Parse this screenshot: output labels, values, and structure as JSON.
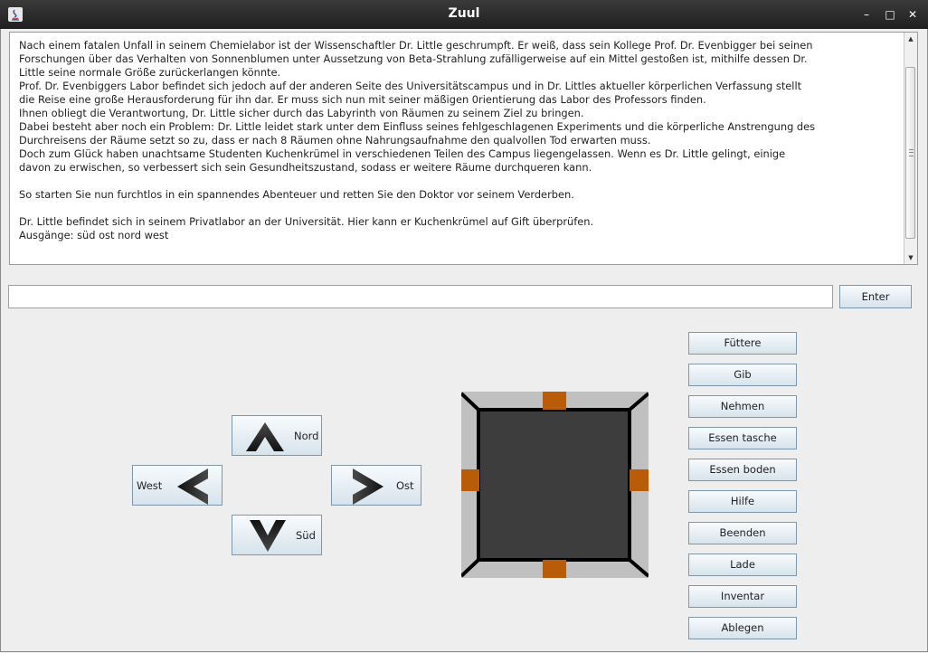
{
  "window": {
    "title": "Zuul",
    "minimize": "–",
    "maximize": "□",
    "close": "✕"
  },
  "story": {
    "text": "Nach einem fatalen Unfall in seinem Chemielabor ist der Wissenschaftler Dr. Little geschrumpft. Er weiß, dass sein Kollege Prof. Dr. Evenbigger bei seinen\nForschungen über das Verhalten von Sonnenblumen unter Aussetzung von Beta-Strahlung zufälligerweise auf ein Mittel gestoßen ist, mithilfe dessen Dr.\nLittle seine normale Größe zurückerlangen könnte.\nProf. Dr. Evenbiggers Labor befindet sich jedoch auf der anderen Seite des Universitätscampus und in Dr. Littles aktueller körperlichen Verfassung stellt\ndie Reise eine große Herausforderung für ihn dar. Er muss sich nun mit seiner mäßigen 0rientierung das Labor des Professors finden.\nIhnen obliegt die Verantwortung, Dr. Little sicher durch das Labyrinth von Räumen zu seinem Ziel zu bringen.\nDabei besteht aber noch ein Problem: Dr. Little leidet stark unter dem Einfluss seines fehlgeschlagenen Experiments und die körperliche Anstrengung des\nDurchreisens der Räume setzt so zu, dass er nach 8 Räumen ohne Nahrungsaufnahme den qualvollen Tod erwarten muss.\nDoch zum Glück haben unachtsame Studenten Kuchenkrümel in verschiedenen Teilen des Campus liegengelassen. Wenn es Dr. Little gelingt, einige\ndavon zu erwischen, so verbessert sich sein Gesundheitszustand, sodass er weitere Räume durchqueren kann.\n\nSo starten Sie nun furchtlos in ein spannendes Abenteuer und retten Sie den Doktor vor seinem Verderben.\n\nDr. Little befindet sich in seinem Privatlabor an der Universität. Hier kann er Kuchenkrümel auf Gift überprüfen.\nAusgänge: süd ost nord west"
  },
  "command": {
    "value": "",
    "placeholder": "",
    "enter_label": "Enter"
  },
  "navigation": {
    "north": "Nord",
    "west": "West",
    "east": "Ost",
    "south": "Süd"
  },
  "room_map": {
    "exits": [
      "nord",
      "ost",
      "süd",
      "west"
    ],
    "floor_color": "#3d3d3d",
    "door_color": "#b85c0a",
    "wall_color": "#c0c0c0"
  },
  "actions": [
    "Füttere",
    "Gib",
    "Nehmen",
    "Essen tasche",
    "Essen boden",
    "Hilfe",
    "Beenden",
    "Lade",
    "Inventar",
    "Ablegen"
  ]
}
